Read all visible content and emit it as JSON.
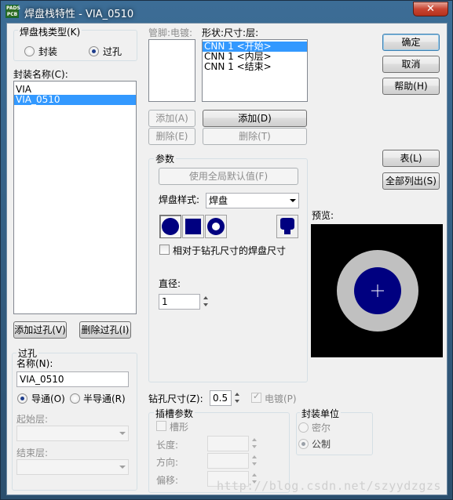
{
  "window": {
    "title": "焊盘栈特性 - VIA_0510",
    "app_icon_lines": [
      "PADS",
      "PCB"
    ],
    "close_glyph": "✕"
  },
  "padstack_type": {
    "title": "焊盘栈类型(K)",
    "options": [
      {
        "label": "封装",
        "selected": false
      },
      {
        "label": "过孔",
        "selected": true
      }
    ]
  },
  "package": {
    "label": "封装名称(C):",
    "items": [
      {
        "text": "VIA",
        "selected": false
      },
      {
        "text": "VIA_0510",
        "selected": true
      }
    ],
    "add_via_button": "添加过孔(V)",
    "delete_via_button": "删除过孔(I)"
  },
  "via": {
    "group_title": "过孔",
    "name_label": "名称(N):",
    "name_value": "VIA_0510",
    "through_label": "导通(O)",
    "partial_label": "半导通(R)",
    "through_selected": true,
    "start_layer_label": "起始层:",
    "end_layer_label": "结束层:"
  },
  "pin_plating": {
    "label": "管脚:电镀:",
    "add_button": "添加(A)",
    "delete_button": "删除(E)"
  },
  "shape_size_layer": {
    "label": "形状:尺寸:层:",
    "items": [
      {
        "text": "CNN 1 <开始>",
        "selected": true
      },
      {
        "text": "CNN 1 <内层>",
        "selected": false
      },
      {
        "text": "CNN 1 <结束>",
        "selected": false
      }
    ],
    "add_button": "添加(D)",
    "delete_button": "删除(T)"
  },
  "params": {
    "group_title": "参数",
    "use_global_button": "使用全局默认值(F)",
    "pad_style_label": "焊盘样式:",
    "pad_style_value": "焊盘",
    "shape_icons": [
      "round-pad-icon",
      "square-pad-icon",
      "annular-pad-icon",
      "odd-shape-pad-icon"
    ],
    "relative_size_label": "相对于钻孔尺寸的焊盘尺寸",
    "relative_size_checked": false,
    "diameter_label": "直径:",
    "diameter_value": "1"
  },
  "drill": {
    "size_label": "钻孔尺寸(Z):",
    "size_value": "0.5",
    "plated_label": "电镀(P)",
    "plated_checked": true
  },
  "slot": {
    "group_title": "插槽参数",
    "slot_label": "槽形",
    "length_label": "长度:",
    "direction_label": "方向:",
    "offset_label": "偏移:"
  },
  "units": {
    "group_title": "封装单位",
    "mil_label": "密尔",
    "metric_label": "公制",
    "metric_selected": true
  },
  "buttons": {
    "ok": "确定",
    "cancel": "取消",
    "help": "帮助(H)",
    "table": "表(L)",
    "list_all": "全部列出(S)"
  },
  "preview": {
    "label": "预览:",
    "colors": {
      "background": "#000000",
      "drill_ring": "#c0c0c0",
      "pad": "#000080",
      "crosshair": "#ffffff"
    }
  },
  "watermark": "http://blog.csdn.net/szyydzgzs"
}
